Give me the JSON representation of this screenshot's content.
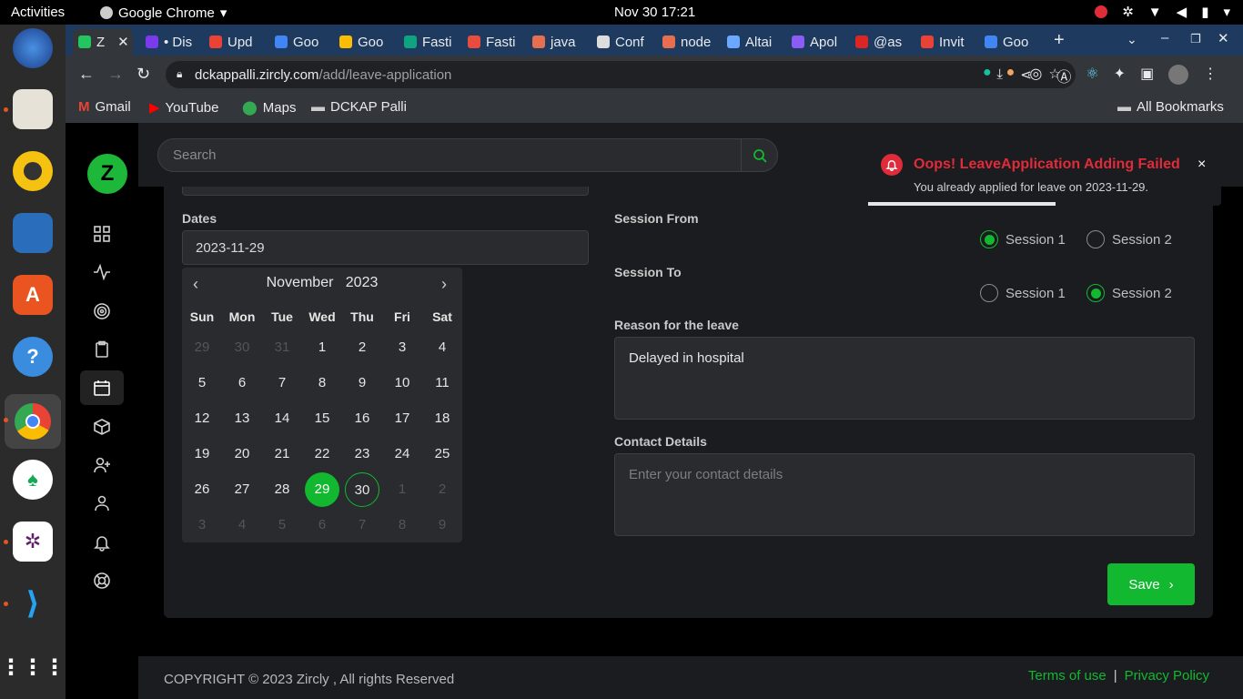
{
  "system": {
    "activities": "Activities",
    "app_name": "Google Chrome",
    "clock": "Nov 30  17:21"
  },
  "browser": {
    "tabs": [
      {
        "label": "Z",
        "active": true,
        "color": "#22c55e"
      },
      {
        "label": "• Dis",
        "color": "#7c3aed"
      },
      {
        "label": "Upd",
        "color": "#ea4335"
      },
      {
        "label": "Goo",
        "color": "#4285f4"
      },
      {
        "label": "Goo",
        "color": "#fbbc04"
      },
      {
        "label": "Fasti",
        "color": "#10a37f"
      },
      {
        "label": "Fasti",
        "color": "#e74c3c"
      },
      {
        "label": "java",
        "color": "#e76f51"
      },
      {
        "label": "Conf",
        "color": "#dddddd"
      },
      {
        "label": "node",
        "color": "#e76f51"
      },
      {
        "label": "Altai",
        "color": "#6aa9ff"
      },
      {
        "label": "Apol",
        "color": "#8b5cf6"
      },
      {
        "label": "@as",
        "color": "#dc2626"
      },
      {
        "label": "Invit",
        "color": "#ea4335"
      },
      {
        "label": "Goo",
        "color": "#4285f4"
      }
    ],
    "url_domain": "dckappalli.zircly.com",
    "url_path": "/add/leave-application",
    "bookmarks": [
      {
        "label": "Gmail",
        "icon": "gmail-icon"
      },
      {
        "label": "YouTube",
        "icon": "youtube-icon"
      },
      {
        "label": "Maps",
        "icon": "maps-icon"
      },
      {
        "label": "DCKAP Palli",
        "icon": "folder-icon"
      }
    ],
    "all_bookmarks": "All Bookmarks"
  },
  "header": {
    "search_placeholder": "Search"
  },
  "form": {
    "dates_label": "Dates",
    "dates_value": "2023-11-29",
    "session_from_label": "Session From",
    "session_to_label": "Session To",
    "session1": "Session 1",
    "session2": "Session 2",
    "session_from_selected": "Session 1",
    "session_to_selected": "Session 2",
    "reason_label": "Reason for the leave",
    "reason_value": "Delayed in hospital",
    "contact_label": "Contact Details",
    "contact_placeholder": "Enter your contact details",
    "save_label": "Save"
  },
  "calendar": {
    "month": "November",
    "year": "2023",
    "weekdays": [
      "Sun",
      "Mon",
      "Tue",
      "Wed",
      "Thu",
      "Fri",
      "Sat"
    ],
    "weeks": [
      [
        "29",
        "30",
        "31",
        "1",
        "2",
        "3",
        "4"
      ],
      [
        "5",
        "6",
        "7",
        "8",
        "9",
        "10",
        "11"
      ],
      [
        "12",
        "13",
        "14",
        "15",
        "16",
        "17",
        "18"
      ],
      [
        "19",
        "20",
        "21",
        "22",
        "23",
        "24",
        "25"
      ],
      [
        "26",
        "27",
        "28",
        "29",
        "30",
        "1",
        "2"
      ],
      [
        "3",
        "4",
        "5",
        "6",
        "7",
        "8",
        "9"
      ]
    ],
    "selected_day": "29",
    "today_day": "30"
  },
  "toast": {
    "title": "Oops! LeaveApplication Adding Failed",
    "message": "You already applied for leave on 2023-11-29.",
    "close": "×",
    "progress": 0.53
  },
  "footer": {
    "copyright": "COPYRIGHT © 2023 Zircly , All rights Reserved",
    "terms": "Terms of use",
    "separator": "|",
    "privacy": "Privacy Policy"
  },
  "colors": {
    "accent": "#12b82f",
    "error": "#e02b3a"
  }
}
